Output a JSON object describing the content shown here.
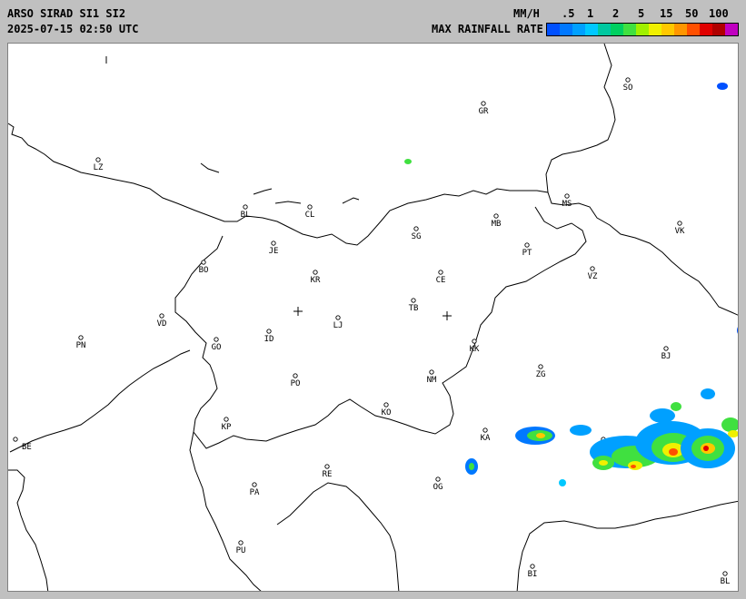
{
  "header": {
    "title": "ARSO SIRAD SI1 SI2",
    "timestamp": "2025-07-15 02:50 UTC",
    "units_label": "MM/H",
    "legend_title": "MAX RAINFALL RATE",
    "scale_ticks": [
      ".5",
      "1",
      "2",
      "5",
      "15",
      "50",
      "100"
    ],
    "scale_colors": [
      "#0050ff",
      "#0078ff",
      "#00a0ff",
      "#00c8ff",
      "#00c8a0",
      "#00d060",
      "#40e040",
      "#a0f000",
      "#f0f000",
      "#ffc800",
      "#ff9600",
      "#ff5000",
      "#e00000",
      "#b00000",
      "#c000c0"
    ]
  },
  "map": {
    "cities": [
      {
        "code": "SO"
      },
      {
        "code": "GR"
      },
      {
        "code": "LZ"
      },
      {
        "code": "MS"
      },
      {
        "code": "BL"
      },
      {
        "code": "CL"
      },
      {
        "code": "MB"
      },
      {
        "code": "VK"
      },
      {
        "code": "SG"
      },
      {
        "code": "JE"
      },
      {
        "code": "PT"
      },
      {
        "code": "BO"
      },
      {
        "code": "KR"
      },
      {
        "code": "CE"
      },
      {
        "code": "VZ"
      },
      {
        "code": "TB"
      },
      {
        "code": "VD"
      },
      {
        "code": "LJ"
      },
      {
        "code": "PN"
      },
      {
        "code": "ID"
      },
      {
        "code": "GO"
      },
      {
        "code": "KK"
      },
      {
        "code": "BJ"
      },
      {
        "code": "ZG"
      },
      {
        "code": "PO"
      },
      {
        "code": "NM"
      },
      {
        "code": "KO"
      },
      {
        "code": "KP"
      },
      {
        "code": "KA"
      },
      {
        "code": "SI"
      },
      {
        "code": "BE"
      },
      {
        "code": "RE"
      },
      {
        "code": "PA"
      },
      {
        "code": "OG"
      },
      {
        "code": "PU"
      },
      {
        "code": "BI"
      },
      {
        "code": "BL"
      }
    ]
  }
}
